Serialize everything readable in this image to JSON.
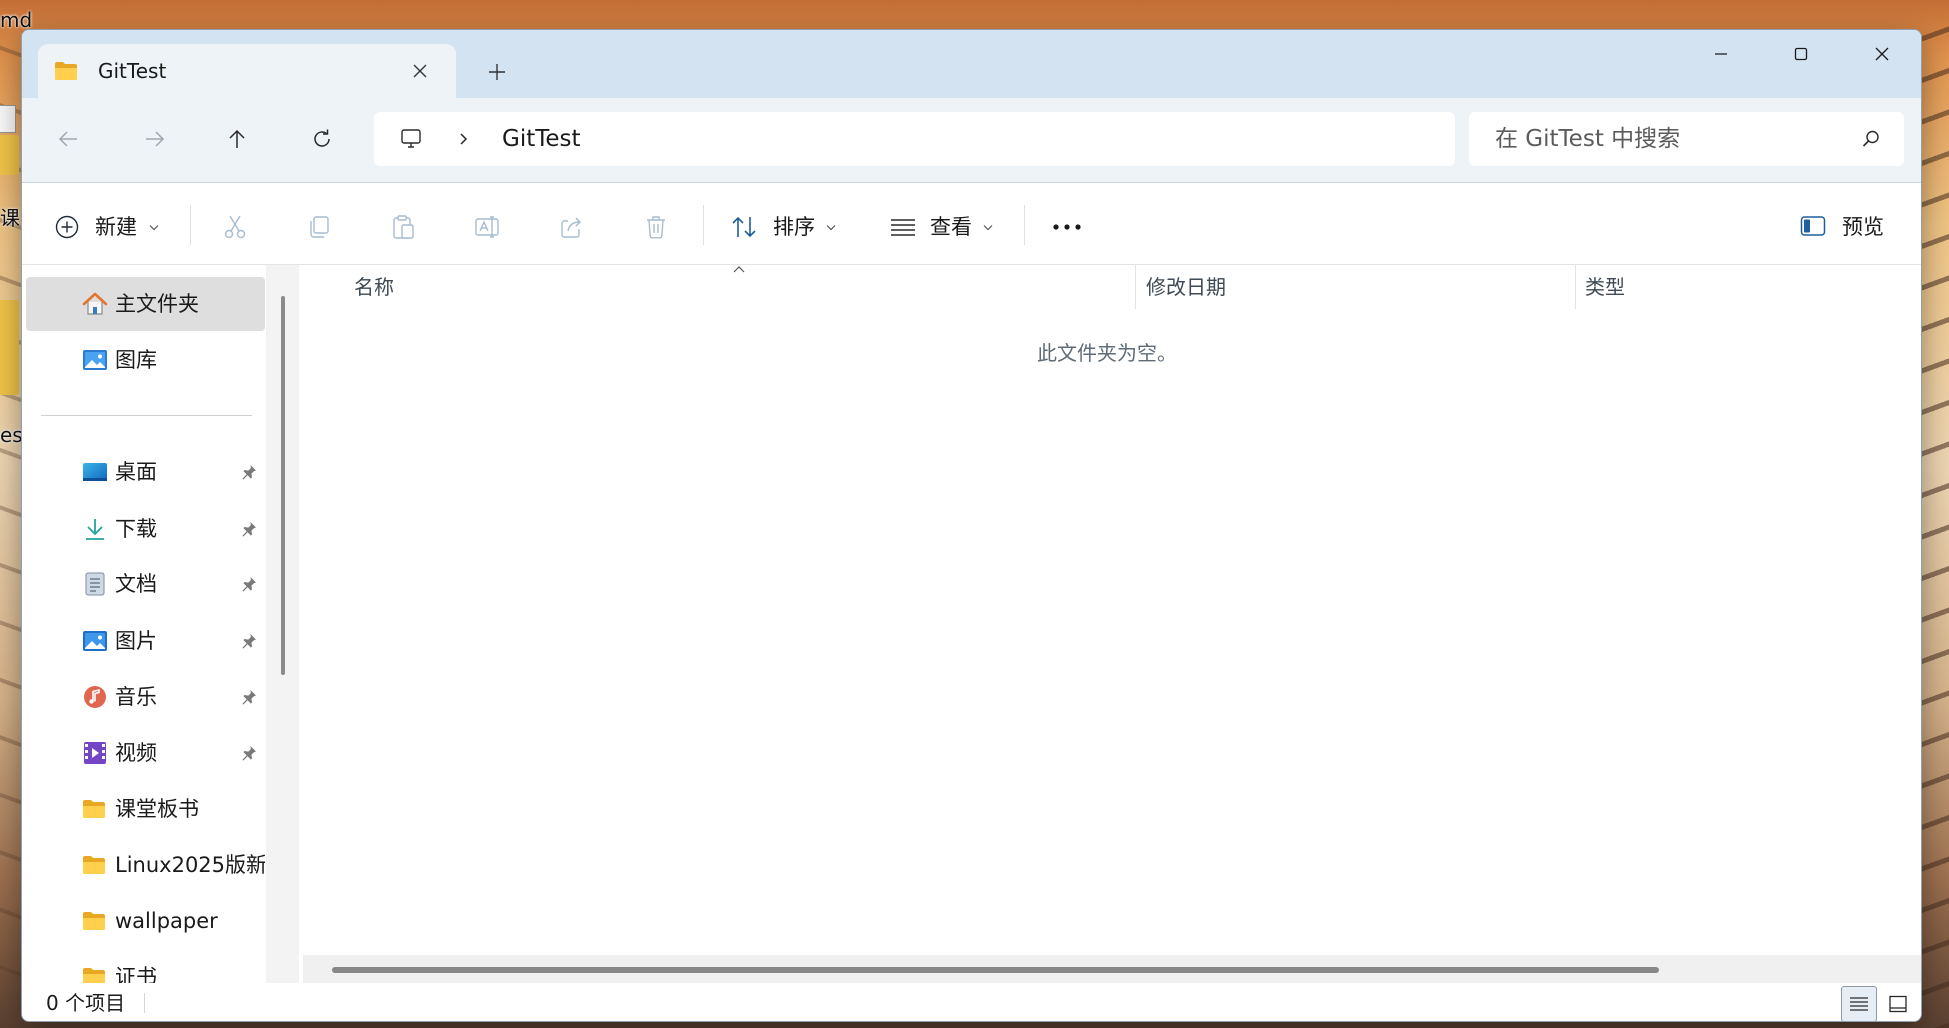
{
  "desktop": {
    "labels": [
      "md",
      "课",
      "est"
    ]
  },
  "tab": {
    "title": "GitTest",
    "icon": "folder-icon",
    "close_icon": "close-tab-icon"
  },
  "new_tab_icon": "plus-icon",
  "window_controls": {
    "minimize": "minimize-icon",
    "maximize": "maximize-icon",
    "close": "close-icon"
  },
  "nav": {
    "back": {
      "icon": "arrow-left-icon",
      "enabled": false
    },
    "forward": {
      "icon": "arrow-right-icon",
      "enabled": false
    },
    "up": {
      "icon": "arrow-up-icon",
      "enabled": true
    },
    "refresh": {
      "icon": "refresh-icon",
      "enabled": true
    }
  },
  "address": {
    "root_icon": "computer-icon",
    "separator_icon": "chevron-right-icon",
    "segments": [
      "GitTest"
    ]
  },
  "search": {
    "placeholder": "在 GitTest 中搜索",
    "icon": "search-icon"
  },
  "toolbar": {
    "new": {
      "label": "新建",
      "icon": "plus-circle-icon"
    },
    "actions": [
      {
        "icon": "scissors-icon",
        "enabled": false
      },
      {
        "icon": "copy-icon",
        "enabled": false
      },
      {
        "icon": "paste-icon",
        "enabled": false
      },
      {
        "icon": "rename-icon",
        "enabled": false
      },
      {
        "icon": "share-icon",
        "enabled": false
      },
      {
        "icon": "trash-icon",
        "enabled": false
      }
    ],
    "sort": {
      "label": "排序",
      "icon": "sort-icon"
    },
    "view": {
      "label": "查看",
      "icon": "view-lines-icon"
    },
    "more_icon": "more-icon",
    "preview": {
      "label": "预览",
      "icon": "preview-pane-icon"
    }
  },
  "sidebar": {
    "items": [
      {
        "label": "主文件夹",
        "icon": "home-icon",
        "selected": true
      },
      {
        "label": "图库",
        "icon": "gallery-icon"
      },
      {
        "label": "桌面",
        "icon": "desktop-icon",
        "pinned": true
      },
      {
        "label": "下载",
        "icon": "download-icon",
        "pinned": true
      },
      {
        "label": "文档",
        "icon": "documents-icon",
        "pinned": true
      },
      {
        "label": "图片",
        "icon": "pictures-icon",
        "pinned": true
      },
      {
        "label": "音乐",
        "icon": "music-icon",
        "pinned": true
      },
      {
        "label": "视频",
        "icon": "videos-icon",
        "pinned": true
      },
      {
        "label": "课堂板书",
        "icon": "folder-icon"
      },
      {
        "label": "Linux2025版新",
        "icon": "folder-icon"
      },
      {
        "label": "wallpaper",
        "icon": "folder-icon"
      },
      {
        "label": "证书",
        "icon": "folder-icon"
      }
    ]
  },
  "columns": [
    {
      "label": "名称",
      "sort_ascending": true
    },
    {
      "label": "修改日期"
    },
    {
      "label": "类型"
    }
  ],
  "content": {
    "empty_message": "此文件夹为空。"
  },
  "status": {
    "item_count": "0 个项目",
    "details_view_active": true
  },
  "colors": {
    "tab_strip": "#d3e3f1",
    "nav_bg": "#eef3f8",
    "selected_bg": "#dedede",
    "folder": "#f3b82c",
    "disabled_icon": "#a7bccf",
    "accent": "#1f5f9c"
  }
}
